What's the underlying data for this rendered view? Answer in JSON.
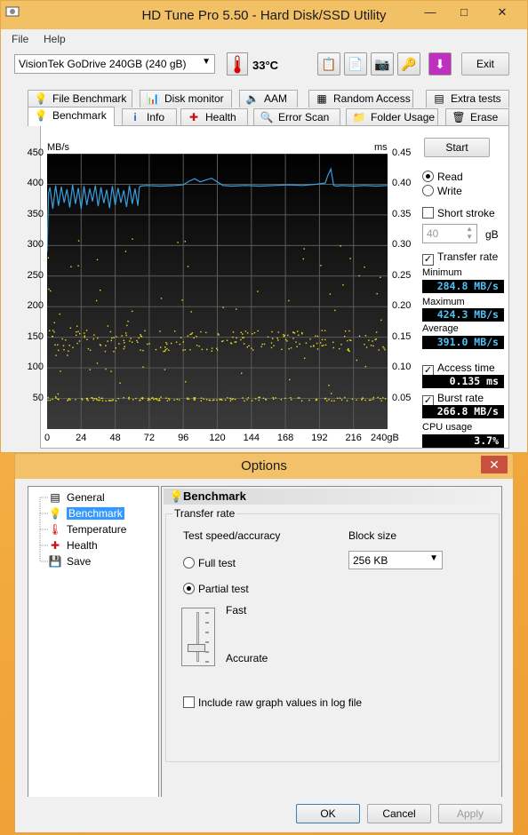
{
  "app": {
    "title": "HD Tune Pro 5.50 - Hard Disk/SSD Utility",
    "menu": [
      "File",
      "Help"
    ],
    "drive": "VisionTek GoDrive 240GB (240 gB)",
    "temperature": "33°C",
    "exit_label": "Exit",
    "tabs_top": [
      {
        "label": "File Benchmark",
        "icon": "file-benchmark-icon"
      },
      {
        "label": "Disk monitor",
        "icon": "disk-monitor-icon"
      },
      {
        "label": "AAM",
        "icon": "speaker-icon"
      },
      {
        "label": "Random Access",
        "icon": "random-access-icon"
      },
      {
        "label": "Extra tests",
        "icon": "extra-tests-icon"
      }
    ],
    "tabs_bottom": [
      {
        "label": "Benchmark",
        "icon": "bulb-icon",
        "selected": true
      },
      {
        "label": "Info",
        "icon": "info-icon"
      },
      {
        "label": "Health",
        "icon": "health-cross-icon"
      },
      {
        "label": "Error Scan",
        "icon": "magnifier-icon"
      },
      {
        "label": "Folder Usage",
        "icon": "folder-icon"
      },
      {
        "label": "Erase",
        "icon": "trash-icon"
      }
    ]
  },
  "benchmark": {
    "start_label": "Start",
    "read_label": "Read",
    "write_label": "Write",
    "short_stroke_label": "Short stroke",
    "short_stroke_value": "40",
    "short_stroke_unit": "gB",
    "transfer_rate_label": "Transfer rate",
    "minimum_label": "Minimum",
    "minimum_value": "284.8 MB/s",
    "maximum_label": "Maximum",
    "maximum_value": "424.3 MB/s",
    "average_label": "Average",
    "average_value": "391.0 MB/s",
    "access_time_label": "Access time",
    "access_time_value": "0.135 ms",
    "burst_rate_label": "Burst rate",
    "burst_rate_value": "266.8 MB/s",
    "cpu_usage_label": "CPU usage",
    "cpu_usage_value": "3.7%",
    "colors": {
      "transfer_line": "#3aa0e0",
      "access_dots": "#e8e020",
      "value_text": "#4fc3f7"
    }
  },
  "chart_data": {
    "type": "line",
    "xlabel": "gB",
    "ylabel": "MB/s",
    "y2label": "ms",
    "x_ticks": [
      "0",
      "24",
      "48",
      "72",
      "96",
      "120",
      "144",
      "168",
      "192",
      "216",
      "240gB"
    ],
    "y_ticks": [
      "450",
      "400",
      "350",
      "300",
      "250",
      "200",
      "150",
      "100",
      "50"
    ],
    "y2_ticks": [
      "0.45",
      "0.40",
      "0.35",
      "0.30",
      "0.25",
      "0.20",
      "0.15",
      "0.10",
      "0.05"
    ],
    "xlim": [
      0,
      240
    ],
    "ylim": [
      0,
      450
    ],
    "y2lim": [
      0,
      0.45
    ],
    "grid": true,
    "series": [
      {
        "name": "Transfer rate",
        "x": [
          0,
          1,
          2,
          4,
          6,
          8,
          10,
          12,
          14,
          16,
          18,
          20,
          22,
          24,
          26,
          28,
          30,
          32,
          34,
          36,
          38,
          40,
          42,
          44,
          46,
          48,
          50,
          52,
          54,
          56,
          58,
          60,
          62,
          64,
          65,
          66,
          70,
          80,
          90,
          96,
          100,
          104,
          108,
          112,
          116,
          120,
          124,
          130,
          140,
          150,
          160,
          170,
          180,
          190,
          196,
          198,
          200,
          202,
          204,
          208,
          216,
          224,
          232,
          240
        ],
        "y": [
          290,
          385,
          395,
          360,
          398,
          365,
          396,
          370,
          392,
          362,
          399,
          368,
          394,
          360,
          397,
          366,
          393,
          372,
          398,
          364,
          395,
          369,
          391,
          361,
          397,
          366,
          394,
          370,
          390,
          363,
          398,
          368,
          393,
          365,
          395,
          397,
          398,
          397,
          398,
          399,
          405,
          409,
          404,
          407,
          410,
          404,
          398,
          397,
          398,
          397,
          398,
          399,
          398,
          400,
          402,
          415,
          425,
          398,
          397,
          398,
          397,
          398,
          397,
          398
        ]
      },
      {
        "name": "Access time",
        "access_time_clusters_ms": [
          0.05,
          0.145,
          0.15
        ]
      }
    ]
  },
  "options": {
    "title": "Options",
    "tree": [
      {
        "label": "General",
        "icon": "general-icon"
      },
      {
        "label": "Benchmark",
        "icon": "bulb-icon",
        "selected": true
      },
      {
        "label": "Temperature",
        "icon": "thermometer-icon"
      },
      {
        "label": "Health",
        "icon": "health-cross-icon"
      },
      {
        "label": "Save",
        "icon": "save-icon"
      }
    ],
    "header": "Benchmark",
    "group_label": "Transfer rate",
    "speed_label": "Test speed/accuracy",
    "block_size_label": "Block size",
    "block_size_value": "256 KB",
    "full_test_label": "Full test",
    "partial_test_label": "Partial test",
    "fast_label": "Fast",
    "accurate_label": "Accurate",
    "slider_fraction": 0.75,
    "raw_values_label": "Include raw graph values in log file",
    "ok_label": "OK",
    "cancel_label": "Cancel",
    "apply_label": "Apply"
  }
}
